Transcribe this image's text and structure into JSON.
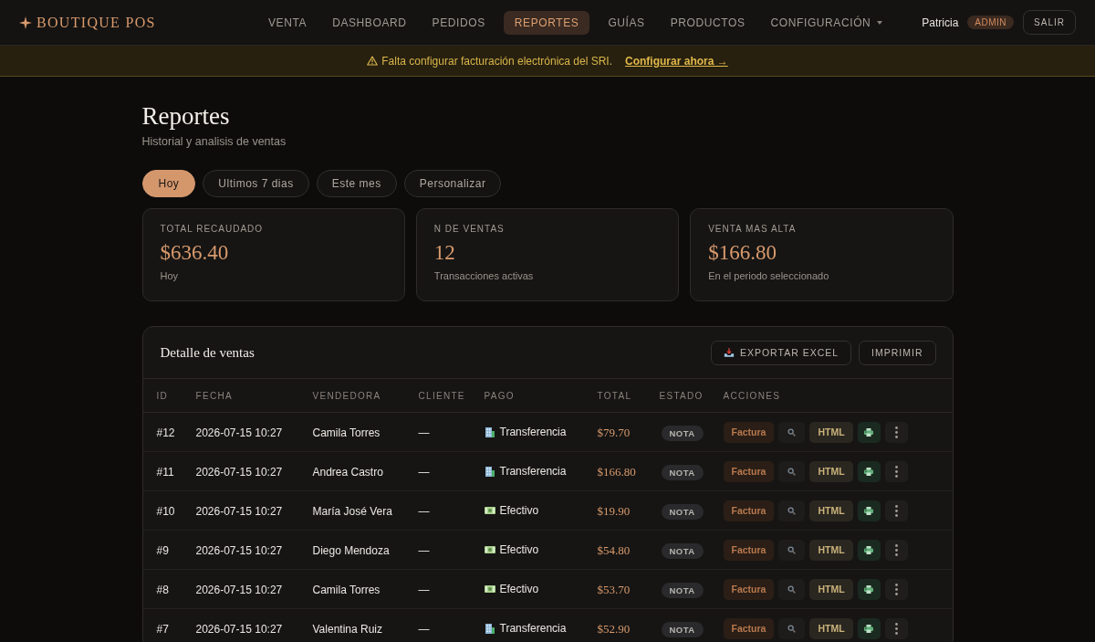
{
  "header": {
    "brand": "BOUTIQUE POS",
    "nav": [
      {
        "label": "VENTA",
        "selected": false,
        "has_menu": false
      },
      {
        "label": "DASHBOARD",
        "selected": false,
        "has_menu": false
      },
      {
        "label": "PEDIDOS",
        "selected": false,
        "has_menu": false
      },
      {
        "label": "REPORTES",
        "selected": true,
        "has_menu": false
      },
      {
        "label": "GUÍAS",
        "selected": false,
        "has_menu": false
      },
      {
        "label": "PRODUCTOS",
        "selected": false,
        "has_menu": false
      },
      {
        "label": "CONFIGURACIÓN",
        "selected": false,
        "has_menu": true
      }
    ],
    "user": {
      "name": "Patricia",
      "role": "ADMIN"
    },
    "logout_button": "SALIR"
  },
  "banner": {
    "message": "Falta configurar facturación electrónica del SRI.",
    "link": "Configurar ahora →"
  },
  "page": {
    "title": "Reportes",
    "subtitle": "Historial y analisis de ventas"
  },
  "filters": [
    {
      "label": "Hoy",
      "selected": true
    },
    {
      "label": "Ultimos 7 dias",
      "selected": false
    },
    {
      "label": "Este mes",
      "selected": false
    },
    {
      "label": "Personalizar",
      "selected": false
    }
  ],
  "stats": [
    {
      "label": "TOTAL RECAUDADO",
      "value": "$636.40",
      "note": "Hoy"
    },
    {
      "label": "N DE VENTAS",
      "value": "12",
      "note": "Transacciones activas"
    },
    {
      "label": "VENTA MAS ALTA",
      "value": "$166.80",
      "note": "En el periodo seleccionado"
    }
  ],
  "sales_table": {
    "title": "Detalle de ventas",
    "export_button": "EXPORTAR EXCEL",
    "print_button": "IMPRIMIR",
    "columns": [
      "ID",
      "FECHA",
      "VENDEDORA",
      "CLIENTE",
      "PAGO",
      "TOTAL",
      "ESTADO",
      "ACCIONES"
    ],
    "rows": [
      {
        "id": "#12",
        "date": "2026-07-15 10:27",
        "seller": "Camila Torres",
        "client": "—",
        "payment": {
          "kind": "transfer",
          "label": "Transferencia"
        },
        "total": "$79.70",
        "status": "NOTA",
        "invoice_button": "Factura",
        "html_button": "HTML"
      },
      {
        "id": "#11",
        "date": "2026-07-15 10:27",
        "seller": "Andrea Castro",
        "client": "—",
        "payment": {
          "kind": "transfer",
          "label": "Transferencia"
        },
        "total": "$166.80",
        "status": "NOTA",
        "invoice_button": "Factura",
        "html_button": "HTML"
      },
      {
        "id": "#10",
        "date": "2026-07-15 10:27",
        "seller": "María José Vera",
        "client": "—",
        "payment": {
          "kind": "cash",
          "label": "Efectivo"
        },
        "total": "$19.90",
        "status": "NOTA",
        "invoice_button": "Factura",
        "html_button": "HTML"
      },
      {
        "id": "#9",
        "date": "2026-07-15 10:27",
        "seller": "Diego Mendoza",
        "client": "—",
        "payment": {
          "kind": "cash",
          "label": "Efectivo"
        },
        "total": "$54.80",
        "status": "NOTA",
        "invoice_button": "Factura",
        "html_button": "HTML"
      },
      {
        "id": "#8",
        "date": "2026-07-15 10:27",
        "seller": "Camila Torres",
        "client": "—",
        "payment": {
          "kind": "cash",
          "label": "Efectivo"
        },
        "total": "$53.70",
        "status": "NOTA",
        "invoice_button": "Factura",
        "html_button": "HTML"
      },
      {
        "id": "#7",
        "date": "2026-07-15 10:27",
        "seller": "Valentina Ruiz",
        "client": "—",
        "payment": {
          "kind": "transfer",
          "label": "Transferencia"
        },
        "total": "$52.90",
        "status": "NOTA",
        "invoice_button": "Factura",
        "html_button": "HTML"
      }
    ]
  }
}
